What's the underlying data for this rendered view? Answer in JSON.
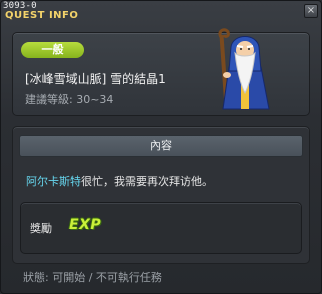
{
  "window": {
    "quest_id": "3093-0",
    "title": "QUEST INFO",
    "close_label": "×"
  },
  "quest": {
    "category": "一般",
    "name": "[冰峰雪域山脈] 雪的結晶1",
    "level_label": "建議等級: 30~34"
  },
  "content": {
    "header": "內容",
    "npc_name": "阿尔卡斯特",
    "description_rest": "很忙，我需要再次拜访他。"
  },
  "reward": {
    "label": "獎勵",
    "exp_text": "EXP"
  },
  "status": {
    "text": "狀態:  可開始 / 不可執行任務"
  },
  "colors": {
    "title": "#f3d36a",
    "category_pill": "#9fcb2b",
    "npc_link": "#66d6ee",
    "exp": "#c9f03a"
  },
  "icons": {
    "npc": "old-wizard-npc-portrait",
    "exp": "exp-icon"
  }
}
